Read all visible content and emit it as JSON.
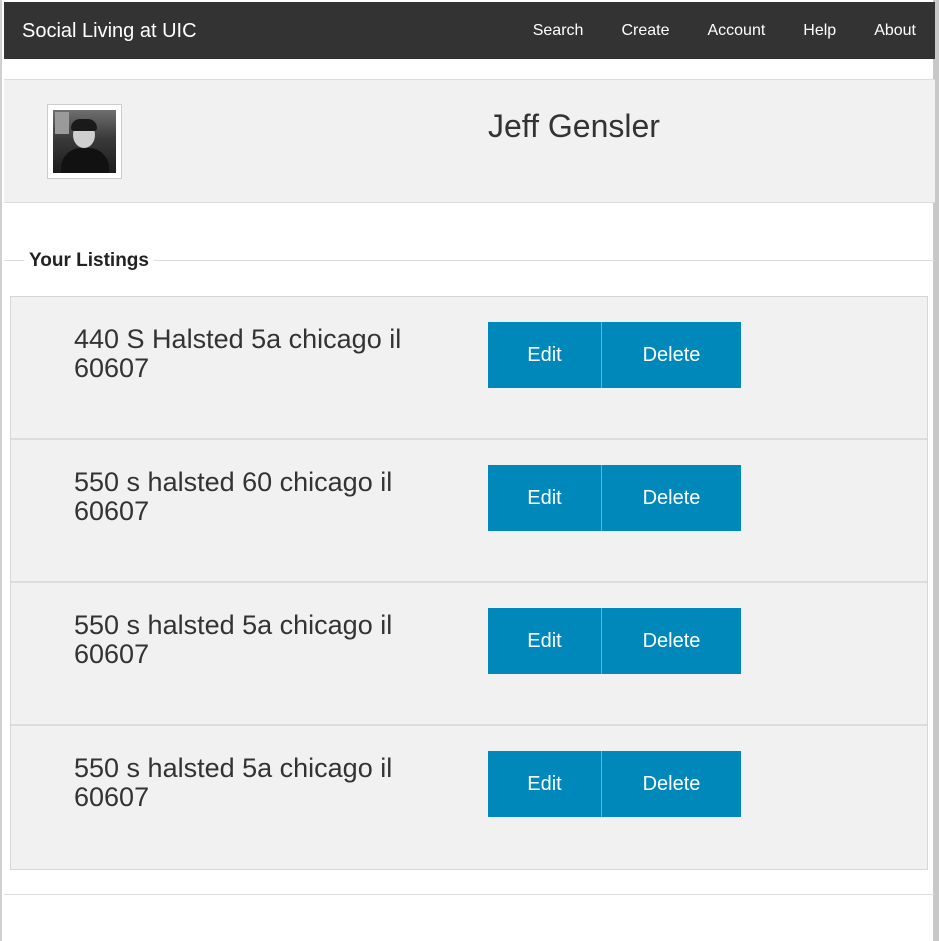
{
  "navbar": {
    "brand": "Social Living at UIC",
    "links": [
      "Search",
      "Create",
      "Account",
      "Help",
      "About"
    ]
  },
  "profile": {
    "name": "Jeff Gensler"
  },
  "listings_section": {
    "legend": "Your Listings",
    "edit_label": "Edit",
    "delete_label": "Delete",
    "items": [
      {
        "address": "440 S Halsted 5a chicago il 60607"
      },
      {
        "address": "550 s halsted 60 chicago il 60607"
      },
      {
        "address": "550 s halsted 5a chicago il 60607"
      },
      {
        "address": "550 s halsted 5a chicago il 60607"
      }
    ]
  },
  "colors": {
    "navbar_bg": "#333333",
    "button_bg": "#0088bb",
    "panel_bg": "#f1f1f1"
  }
}
